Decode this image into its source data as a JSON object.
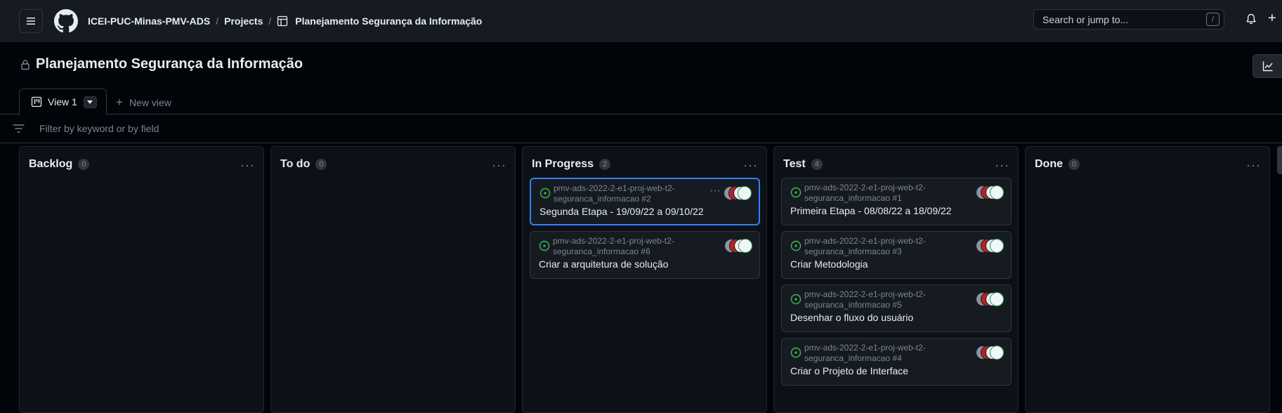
{
  "header": {
    "org": "ICEI-PUC-Minas-PMV-ADS",
    "projects": "Projects",
    "sep": "/",
    "project": "Planejamento Segurança da Informação",
    "search_placeholder": "Search or jump to...",
    "search_kbd": "/"
  },
  "page": {
    "title": "Planejamento Segurança da Informação"
  },
  "tabs": {
    "active": "View 1",
    "new_view": "New view"
  },
  "filter": {
    "placeholder": "Filter by keyword or by field"
  },
  "columns": [
    {
      "name": "Backlog",
      "count": "0",
      "cards": []
    },
    {
      "name": "To do",
      "count": "0",
      "cards": []
    },
    {
      "name": "In Progress",
      "count": "2",
      "cards": [
        {
          "repo": "pmv-ads-2022-2-e1-proj-web-t2-",
          "ref": "seguranca_informacao #2",
          "title": "Segunda Etapa - 19/09/22 a 09/10/22",
          "selected": true
        },
        {
          "repo": "pmv-ads-2022-2-e1-proj-web-t2-",
          "ref": "seguranca_informacao #6",
          "title": "Criar a arquitetura de solução",
          "selected": false
        }
      ]
    },
    {
      "name": "Test",
      "count": "4",
      "cards": [
        {
          "repo": "pmv-ads-2022-2-e1-proj-web-t2-",
          "ref": "seguranca_informacao #1",
          "title": "Primeira Etapa - 08/08/22 a 18/09/22",
          "selected": false
        },
        {
          "repo": "pmv-ads-2022-2-e1-proj-web-t2-",
          "ref": "seguranca_informacao #3",
          "title": "Criar Metodologia",
          "selected": false
        },
        {
          "repo": "pmv-ads-2022-2-e1-proj-web-t2-",
          "ref": "seguranca_informacao #5",
          "title": "Desenhar o fluxo do usuário",
          "selected": false
        },
        {
          "repo": "pmv-ads-2022-2-e1-proj-web-t2-",
          "ref": "seguranca_informacao #4",
          "title": "Criar o Projeto de Interface",
          "selected": false
        }
      ]
    },
    {
      "name": "Done",
      "count": "0",
      "cards": []
    }
  ],
  "colors": {
    "accent": "#2f81f7",
    "open_issue": "#3fb950"
  },
  "icons": [
    "hamburger-icon",
    "github-logo-icon",
    "table-icon",
    "bell-icon",
    "plus-icon",
    "lock-icon",
    "insights-icon",
    "board-icon",
    "caret-down-icon",
    "filter-icon",
    "kebab-icon",
    "issue-open-icon"
  ]
}
